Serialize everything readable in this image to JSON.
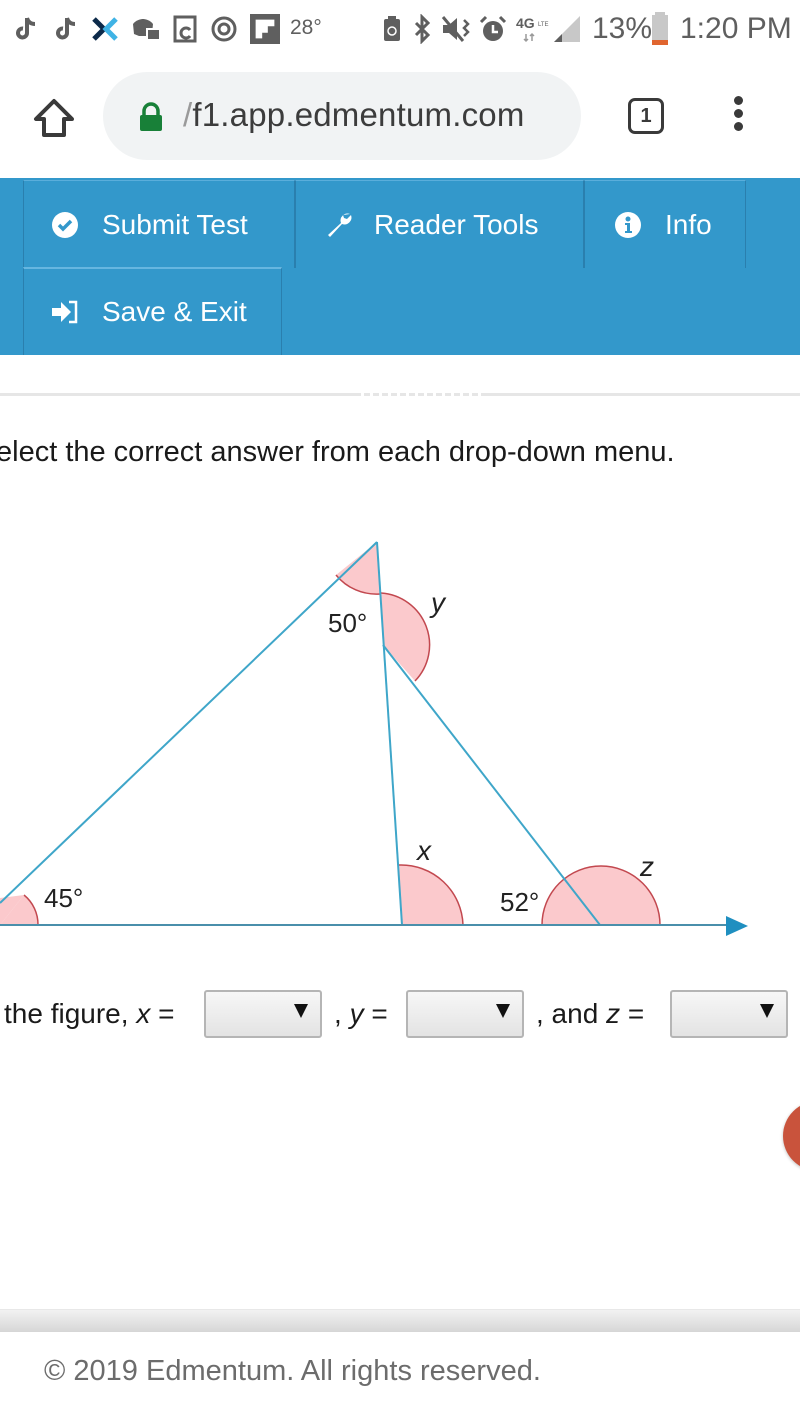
{
  "status_bar": {
    "left_icons": [
      "tiktok-icon",
      "tiktok-icon",
      "xodo-icon",
      "discord-icon",
      "screen-rotate-icon",
      "at-sign-icon",
      "flipboard-icon"
    ],
    "temperature": "28°",
    "right_icons": [
      "battery-saver-icon",
      "bluetooth-icon",
      "vibrate-mute-icon",
      "alarm-icon",
      "4g-lte-icon",
      "signal-icon"
    ],
    "battery_percent": "13%",
    "time": "1:20 PM",
    "battery_color": "#e0652f"
  },
  "browser": {
    "url_prefix": "/",
    "url": "f1.app.edmentum.com",
    "tab_count": "1",
    "lock_color": "#188038"
  },
  "toolbar": {
    "color": "#3398cb",
    "buttons": [
      {
        "label": "Submit Test",
        "icon": "check-circle-icon"
      },
      {
        "label": "Reader Tools",
        "icon": "wrench-icon"
      },
      {
        "label": "Info",
        "icon": "info-circle-icon"
      },
      {
        "label": "Save & Exit",
        "icon": "sign-in-icon"
      }
    ]
  },
  "question": {
    "instructions": "elect the correct answer from each drop-down menu.",
    "figure": {
      "angles": [
        {
          "label": "50°",
          "name": "apex-angle"
        },
        {
          "label": "y",
          "name": "angle-y"
        },
        {
          "label": "x",
          "name": "angle-x"
        },
        {
          "label": "45°",
          "name": "base-left-angle"
        },
        {
          "label": "52°",
          "name": "base-right-angle"
        },
        {
          "label": "z",
          "name": "angle-z"
        }
      ],
      "line_color": "#3fa6c9",
      "arc_fill": "#fbc9cc",
      "arc_stroke": "#c2484f"
    },
    "answer_prefix": "the figure, ",
    "var_x": "x",
    "var_y": "y",
    "var_z": "z",
    "equals": " =",
    "sep_y": ",",
    "sep_z": ", and",
    "dropdowns": [
      {
        "name": "x-dropdown",
        "selected": ""
      },
      {
        "name": "y-dropdown",
        "selected": ""
      },
      {
        "name": "z-dropdown",
        "selected": ""
      }
    ]
  },
  "footer": {
    "copyright": "© 2019 Edmentum. All rights reserved."
  }
}
